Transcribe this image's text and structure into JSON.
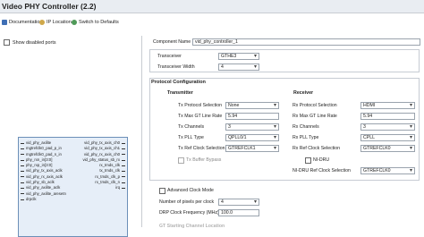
{
  "window": {
    "title": "Video PHY Controller (2.2)"
  },
  "toolbar": {
    "documentation": "Documentation",
    "ip_location": "IP Location",
    "defaults": "Switch to Defaults"
  },
  "left": {
    "show_disabled_ports": "Show disabled ports",
    "ports_left": [
      "vid_phy_axilite",
      "mgtrefclk0_pad_p_in",
      "mgtrefclk0_pad_n_in",
      "phy_rxn_in[3:0]",
      "phy_rxp_in[3:0]",
      "vid_phy_tx_axis_aclk",
      "vid_phy_rx_axis_aclk",
      "vid_phy_sb_aclk",
      "vid_phy_axilite_aclk",
      "vid_phy_axilite_aresetn",
      "drpclk"
    ],
    "ports_right": [
      "vid_phy_tx_axis_ch0",
      "vid_phy_tx_axis_ch1",
      "vid_phy_rx_axis_ch0",
      "vid_phy_status_sb_rx",
      "rx_tmds_clk",
      "tx_tmds_clk",
      "rx_tmds_clk_p",
      "rx_tmds_clk_n",
      "irq"
    ]
  },
  "config": {
    "component_name_label": "Component Name",
    "component_name_value": "vid_phy_controller_1",
    "transceiver_label": "Transceiver",
    "transceiver_value": "GTHE3",
    "transceiver_width_label": "Transceiver Width",
    "transceiver_width_value": "4",
    "protocol_config_title": "Protocol Configuration",
    "transmitter": {
      "title": "Transmitter",
      "protocol_selection_label": "Tx Protocol Selection",
      "protocol_selection_value": "None",
      "max_gt_line_rate_label": "Tx Max GT Line Rate",
      "max_gt_line_rate_value": "5.94",
      "channels_label": "Tx Channels",
      "channels_value": "3",
      "pll_type_label": "Tx PLL Type",
      "pll_type_value": "QPLL0/1",
      "ref_clock_label": "Tx Ref Clock Selection",
      "ref_clock_value": "GTREFCLK1",
      "buffer_bypass_label": "Tx Buffer Bypass"
    },
    "receiver": {
      "title": "Receiver",
      "protocol_selection_label": "Rx Protocol Selection",
      "protocol_selection_value": "HDMI",
      "max_gt_line_rate_label": "Rx Max GT Line Rate",
      "max_gt_line_rate_value": "5.94",
      "channels_label": "Rx Channels",
      "channels_value": "3",
      "pll_type_label": "Rx PLL Type",
      "pll_type_value": "CPLL",
      "ref_clock_label": "Rx Ref Clock Selection",
      "ref_clock_value": "GTREFCLK0",
      "nidru_label": "NI-DRU",
      "nidru_ref_label": "NI-DRU Ref Clock Selection",
      "nidru_ref_value": "GTREFCLK0"
    },
    "advanced_clock_mode_label": "Advanced Clock Mode",
    "pixels_per_clock_label": "Number of pixels per clock",
    "pixels_per_clock_value": "4",
    "drp_clock_label": "DRP Clock Frequency (MHz)",
    "drp_clock_value": "100.0",
    "cut_off_heading": "GT Starting Channel Location"
  }
}
